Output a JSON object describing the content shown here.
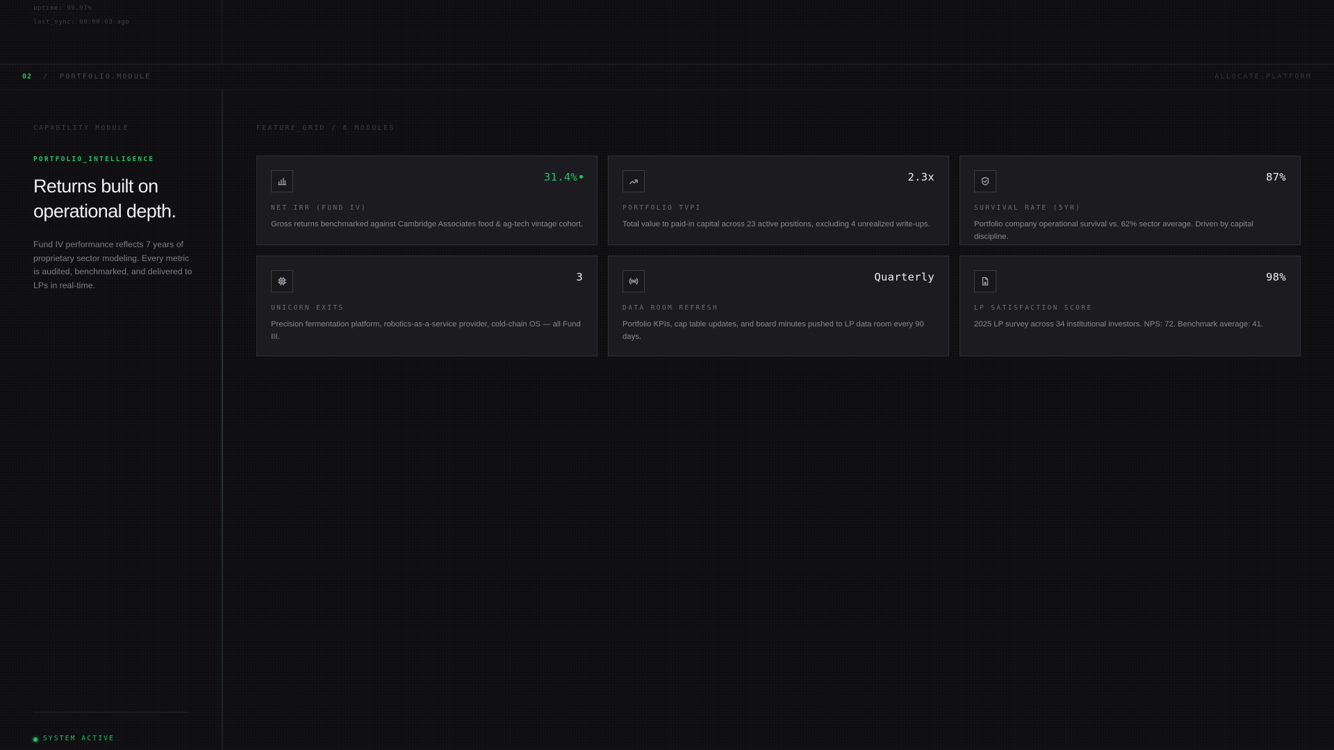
{
  "system": {
    "uptime": "uptime: 99.97%",
    "last_sync": "last_sync: 00:00:03 ago"
  },
  "breadcrumb": {
    "number": "02",
    "separator": "/",
    "label": "PORTFOLIO.MODULE",
    "right": "ALLOCATE.PLATFORM"
  },
  "sidebar": {
    "capability_label": "CAPABILITY MODULE",
    "section_label": "PORTFOLIO_INTELLIGENCE",
    "headline": "Returns built on operational depth.",
    "description": "Fund IV performance reflects 7 years of proprietary sector modeling. Every metric is audited, benchmarked, and delivered to LPs in real-time.",
    "status": "SYSTEM ACTIVE"
  },
  "main": {
    "grid_label": "FEATURE_GRID / 6 MODULES",
    "cards": [
      {
        "icon": "bar-chart-icon",
        "value": "31.4%",
        "value_color": "#25c06a",
        "title": "NET IRR (FUND IV)",
        "body": "Gross returns benchmarked against Cambridge Associates food & ag-tech vintage cohort."
      },
      {
        "icon": "trending-up-icon",
        "value": "2.3x",
        "title": "PORTFOLIO TVPI",
        "body": "Total value to paid-in capital across 23 active positions, excluding 4 unrealized write-ups."
      },
      {
        "icon": "shield-icon",
        "value": "87%",
        "title": "SURVIVAL RATE (5YR)",
        "body": "Portfolio company operational survival vs. 62% sector average. Driven by capital discipline."
      },
      {
        "icon": "chip-icon",
        "value": "3",
        "title": "UNICORN EXITS",
        "body": "Precision fermentation platform, robotics-as-a-service provider, cold-chain OS — all Fund III."
      },
      {
        "icon": "broadcast-icon",
        "value": "Quarterly",
        "title": "DATA ROOM REFRESH",
        "body": "Portfolio KPIs, cap table updates, and board minutes pushed to LP data room every 90 days."
      },
      {
        "icon": "document-icon",
        "value": "98%",
        "title": "LP SATISFACTION SCORE",
        "body": "2025 LP survey across 34 institutional investors. NPS: 72. Benchmark average: 41."
      }
    ]
  }
}
